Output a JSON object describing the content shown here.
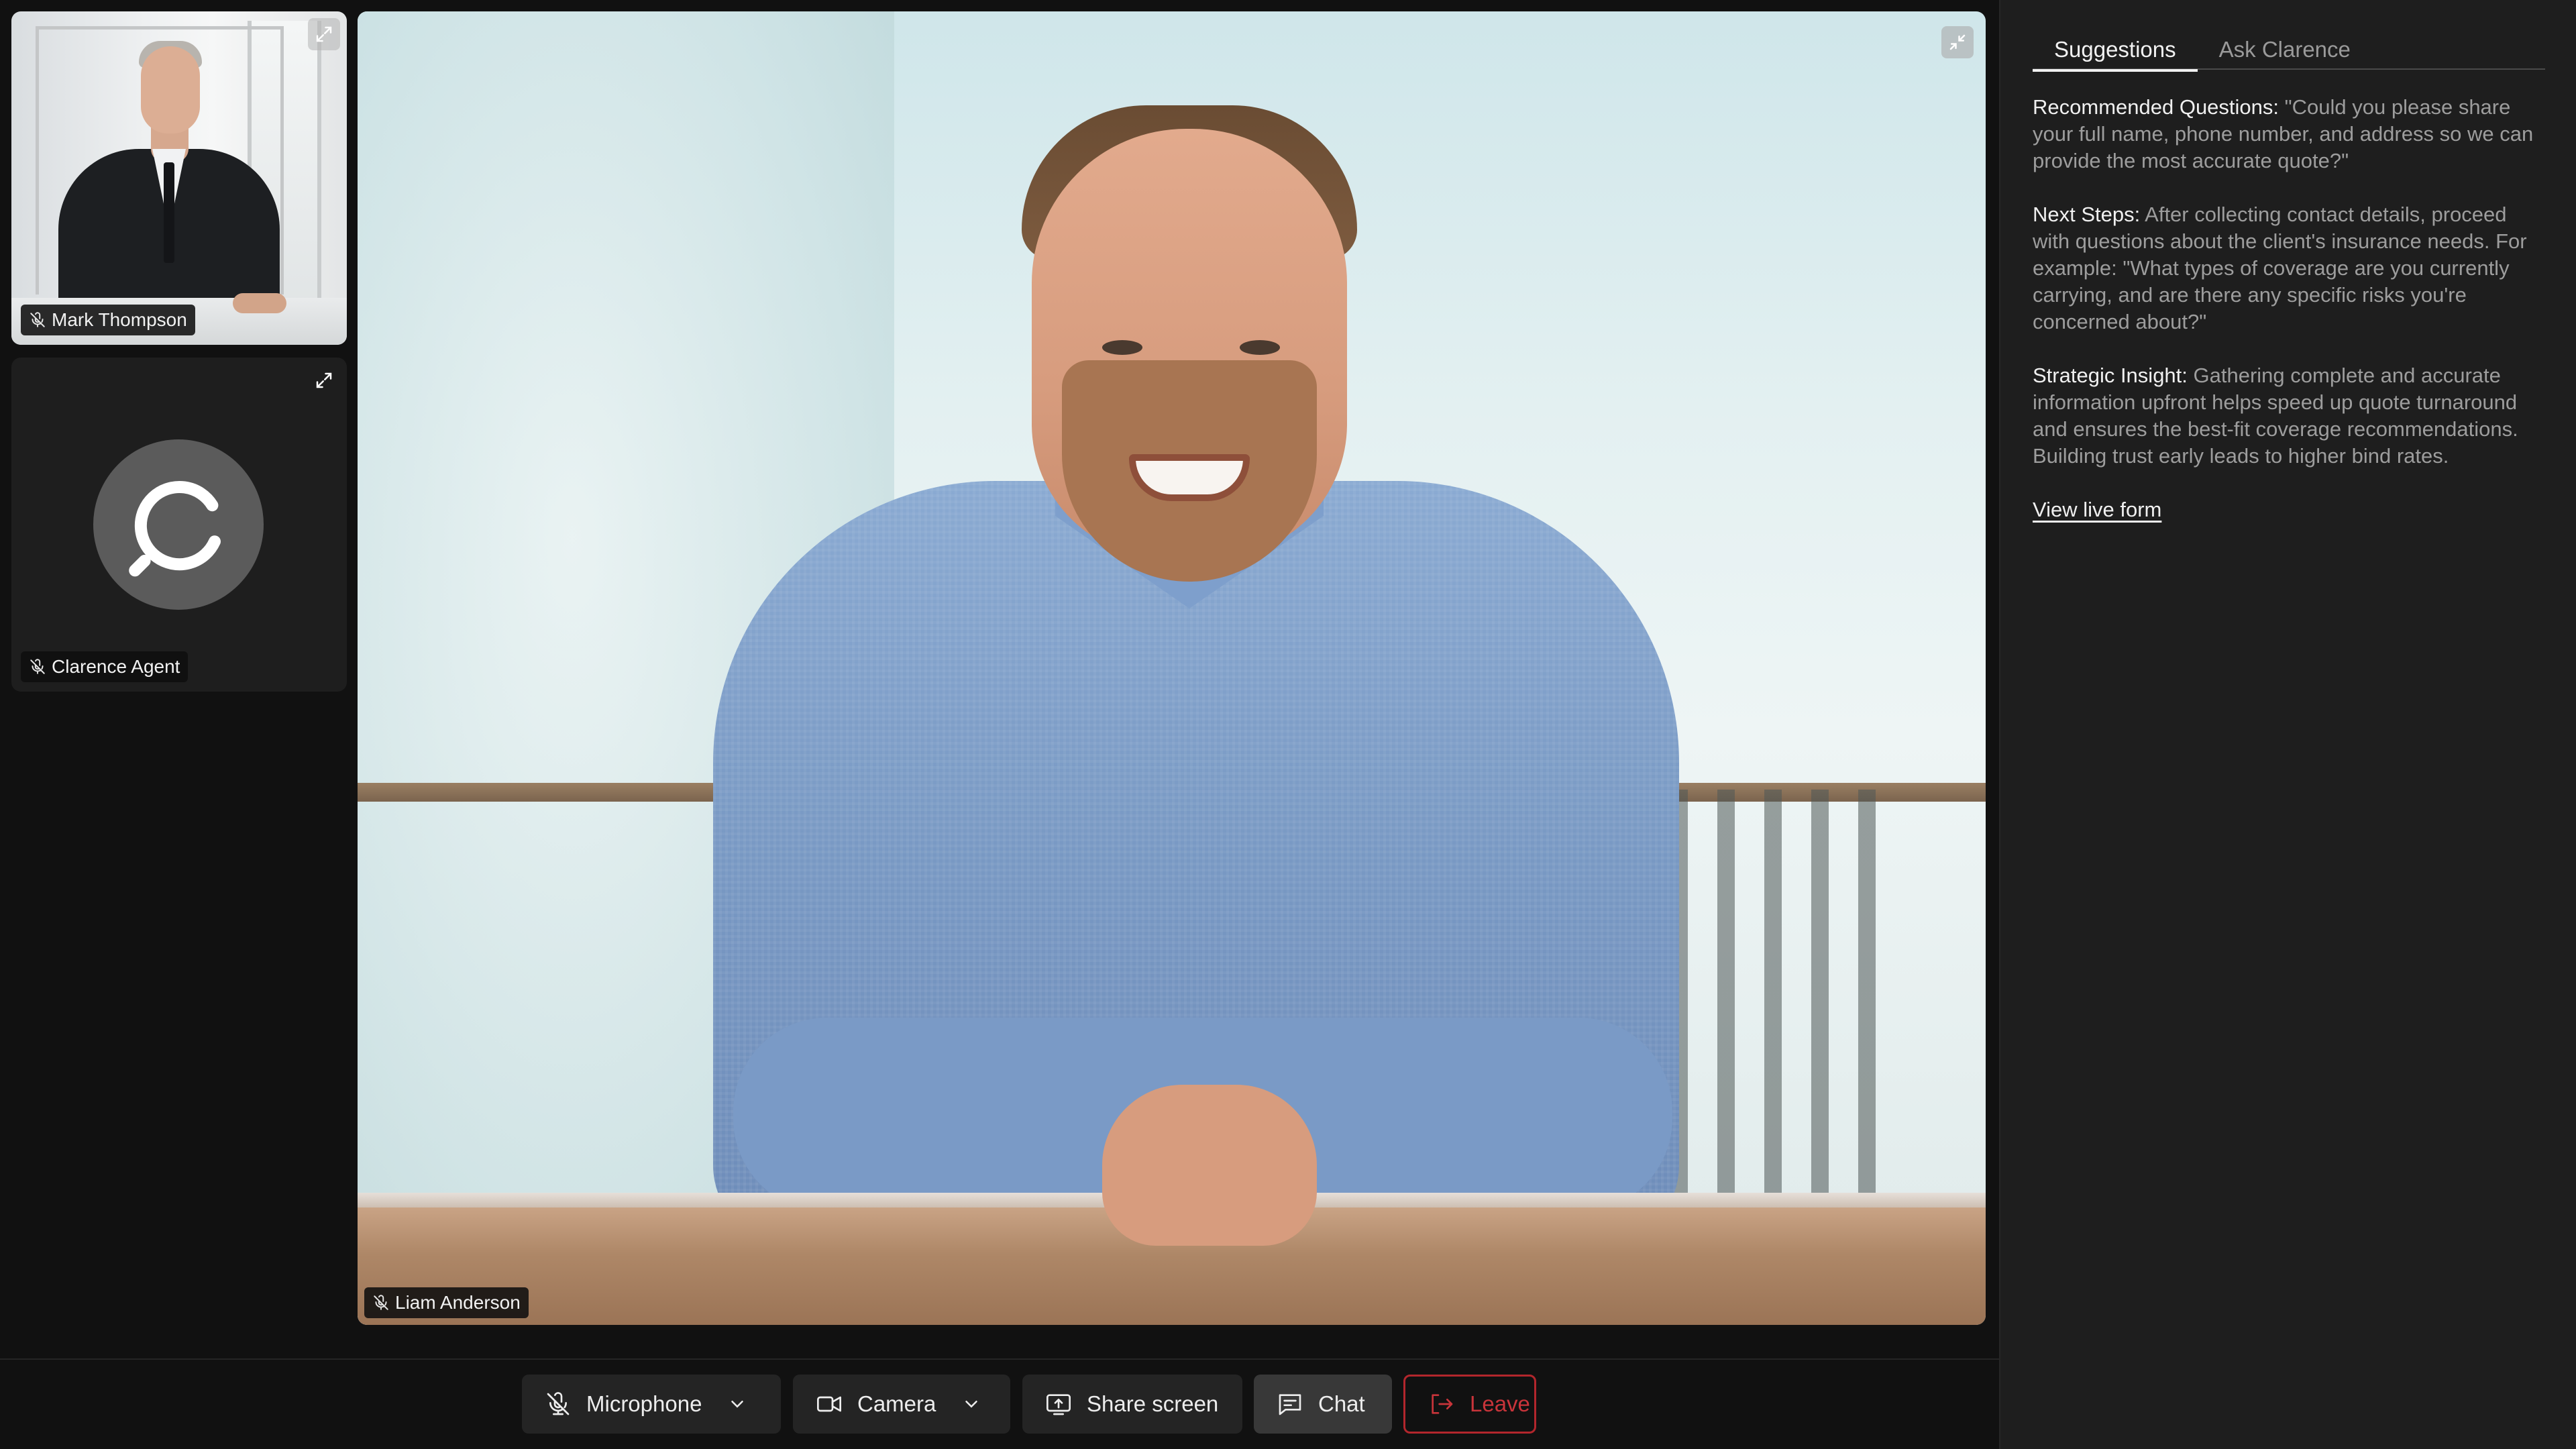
{
  "participants": {
    "mark": {
      "name": "Mark Thompson",
      "muted": true
    },
    "agent": {
      "name": "Clarence Agent",
      "muted": true
    },
    "main": {
      "name": "Liam Anderson",
      "muted": true
    }
  },
  "panel": {
    "tabs": [
      "Suggestions",
      "Ask Clarence"
    ],
    "active_tab": "Suggestions",
    "sections": [
      {
        "label": "Recommended Questions:",
        "text": " \"Could you please share your full name, phone number, and address so we can provide the most accurate quote?\""
      },
      {
        "label": "Next Steps:",
        "text": " After collecting contact details, proceed with questions about the client's insurance needs. For example: \"What types of coverage are you currently carrying, and are there any specific risks you're concerned about?\""
      },
      {
        "label": "Strategic Insight:",
        "text": " Gathering complete and accurate information upfront helps speed up quote turnaround and ensures the best-fit coverage recommendations. Building trust early leads to higher bind rates."
      }
    ],
    "link": "View live form"
  },
  "toolbar": {
    "microphone": "Microphone",
    "camera": "Camera",
    "share": "Share screen",
    "chat": "Chat",
    "leave": "Leave"
  },
  "colors": {
    "leave": "#c8343a",
    "panel_bg": "#1e1e1e",
    "app_bg": "#111111"
  },
  "icons": [
    "mic-off-icon",
    "camera-icon",
    "share-screen-icon",
    "chat-icon",
    "leave-icon",
    "expand-icon",
    "collapse-icon",
    "chevron-down-icon",
    "clarence-logo-icon"
  ]
}
